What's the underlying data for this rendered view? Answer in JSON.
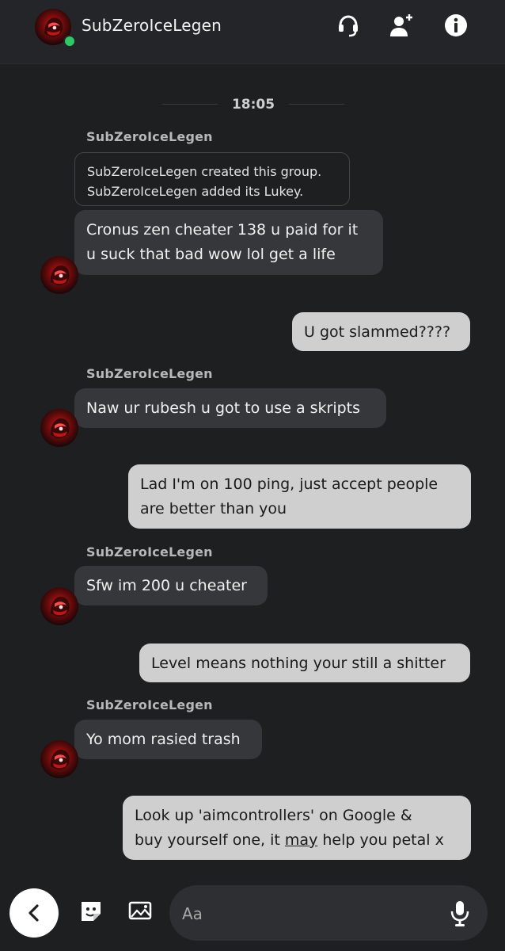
{
  "header": {
    "title": "SubZeroIceLegen",
    "icons": [
      "avatar",
      "headset-icon",
      "add-user-icon",
      "info-icon"
    ],
    "online_color": "#2ec866"
  },
  "chat": {
    "time": "18:05",
    "system_lines": [
      "SubZeroIceLegen created this group.",
      "SubZeroIceLegen added its Lukey."
    ],
    "messages": [
      {
        "side": "in",
        "sender": "SubZeroIceLegen",
        "lines": [
          "Cronus zen cheater 138 u paid for it",
          "u suck that bad wow lol get a life"
        ]
      },
      {
        "side": "out",
        "lines": [
          "U got slammed????"
        ]
      },
      {
        "side": "in",
        "sender": "SubZeroIceLegen",
        "lines": [
          "Naw ur rubesh u got to use a skripts"
        ]
      },
      {
        "side": "out",
        "lines": [
          "Lad I'm on 100 ping, just accept people",
          "are better than you"
        ]
      },
      {
        "side": "in",
        "sender": "SubZeroIceLegen",
        "lines": [
          "Sfw im 200 u cheater"
        ]
      },
      {
        "side": "out",
        "lines": [
          "Level means nothing your still a shitter"
        ]
      },
      {
        "side": "in",
        "sender": "SubZeroIceLegen",
        "lines": [
          "Yo mom rasied trash"
        ]
      },
      {
        "side": "out",
        "lines": [
          "Look up 'aimcontrollers' on Google &",
          "buy yourself one, it may help you petal x"
        ]
      }
    ]
  },
  "composer": {
    "placeholder": "Aa",
    "icons": [
      "back-icon",
      "sticker-icon",
      "image-icon",
      "mic-icon"
    ]
  },
  "colors": {
    "background": "#1e1f21",
    "incoming_bubble": "#36373a",
    "outgoing_bubble": "#cfcfcf"
  }
}
